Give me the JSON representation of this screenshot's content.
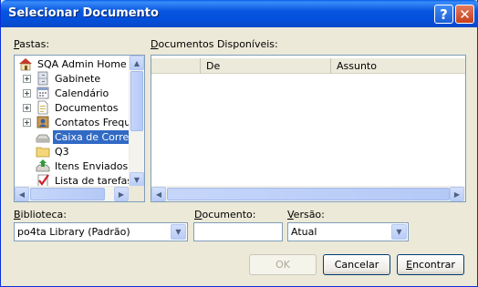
{
  "window": {
    "title": "Selecionar Documento"
  },
  "titlebar": {
    "help_glyph": "?",
    "close_glyph": "✕"
  },
  "folders": {
    "label_accel": "P",
    "label_rest": "astas:",
    "items": [
      {
        "label": "SQA Admin Home",
        "icon": "home-icon",
        "expandable": false,
        "selected": false
      },
      {
        "label": "Gabinete",
        "icon": "cabinet-icon",
        "expandable": true,
        "selected": false
      },
      {
        "label": "Calendário",
        "icon": "calendar-icon",
        "expandable": true,
        "selected": false
      },
      {
        "label": "Documentos",
        "icon": "document-icon",
        "expandable": true,
        "selected": false
      },
      {
        "label": "Contatos Frequentes",
        "icon": "contacts-icon",
        "expandable": true,
        "selected": false
      },
      {
        "label": "Caixa de Correio",
        "icon": "mailbox-icon",
        "expandable": false,
        "selected": true
      },
      {
        "label": "Q3",
        "icon": "folder-icon",
        "expandable": false,
        "selected": false
      },
      {
        "label": "Itens Enviados",
        "icon": "sent-items-icon",
        "expandable": false,
        "selected": false
      },
      {
        "label": "Lista de tarefas",
        "icon": "task-list-icon",
        "expandable": false,
        "selected": false
      }
    ]
  },
  "documents": {
    "label_accel": "D",
    "label_rest": "ocumentos Disponíveis:",
    "columns": [
      "",
      "De",
      "Assunto"
    ]
  },
  "library": {
    "label_accel": "B",
    "label_rest": "iblioteca:",
    "value": "po4ta Library  (Padrão)"
  },
  "document_field": {
    "label_accel": "D",
    "label_rest": "ocumento:",
    "value": ""
  },
  "version": {
    "label_accel": "V",
    "label_rest": "ersão:",
    "value": "Atual"
  },
  "buttons": {
    "ok": "OK",
    "cancel": "Cancelar",
    "find_accel": "E",
    "find_rest": "ncontrar"
  }
}
